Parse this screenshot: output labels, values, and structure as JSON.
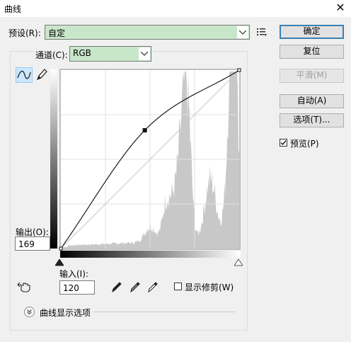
{
  "window": {
    "title": "曲线"
  },
  "preset": {
    "label": "预设(R):",
    "value": "自定"
  },
  "channel": {
    "label": "通道(C):",
    "value": "RGB"
  },
  "buttons": {
    "ok": "确定",
    "reset": "复位",
    "smooth": "平滑(M)",
    "auto": "自动(A)",
    "options": "选项(T)..."
  },
  "preview": {
    "label": "预览(P)",
    "checked": true
  },
  "output": {
    "label": "输出(O):",
    "value": "169"
  },
  "input": {
    "label": "输入(I):",
    "value": "120"
  },
  "show_clipping": {
    "label": "显示修剪(W)",
    "checked": false
  },
  "curve_display_options": {
    "label": "曲线显示选项"
  },
  "curve": {
    "points": [
      [
        0,
        0
      ],
      [
        120,
        169
      ],
      [
        255,
        255
      ]
    ],
    "line_color": "#1a1a1a",
    "histogram_color": "#c8c8c8",
    "grid_color": "#e2e2e2"
  },
  "colors": {
    "combo_bg": "#c8e6c9",
    "primary_border": "#3c7fb1",
    "tool_active_bg": "#cce8ff"
  }
}
